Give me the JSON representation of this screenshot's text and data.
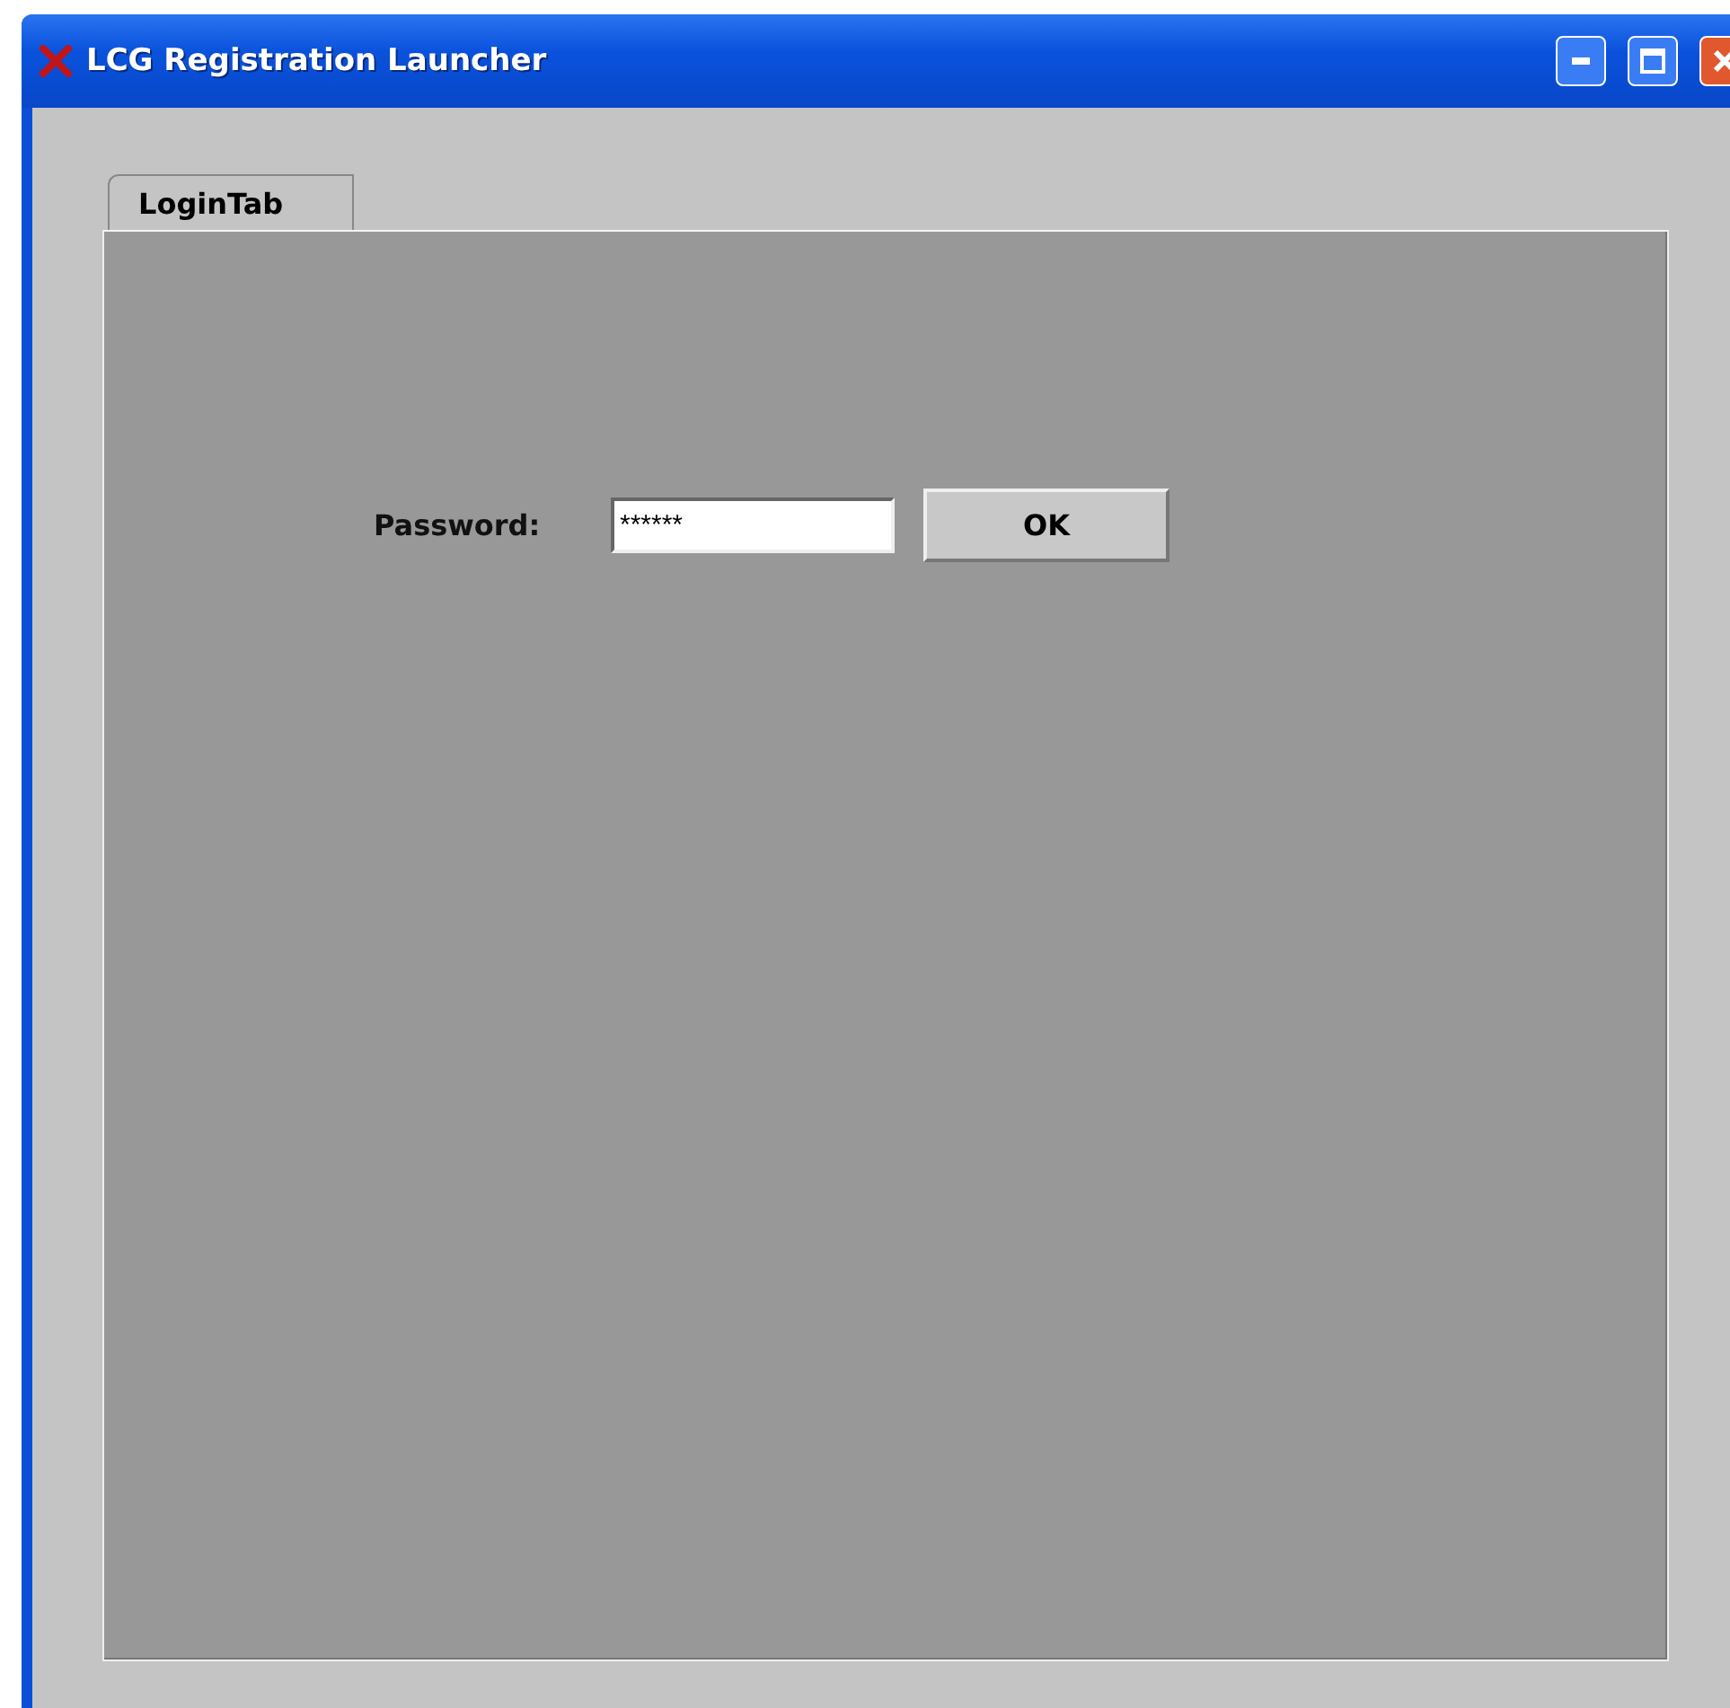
{
  "window": {
    "title": "LCG Registration Launcher"
  },
  "tabs": [
    {
      "label": "LoginTab",
      "selected": true
    }
  ],
  "login": {
    "label": "Password:",
    "value": "******",
    "button": "OK"
  }
}
